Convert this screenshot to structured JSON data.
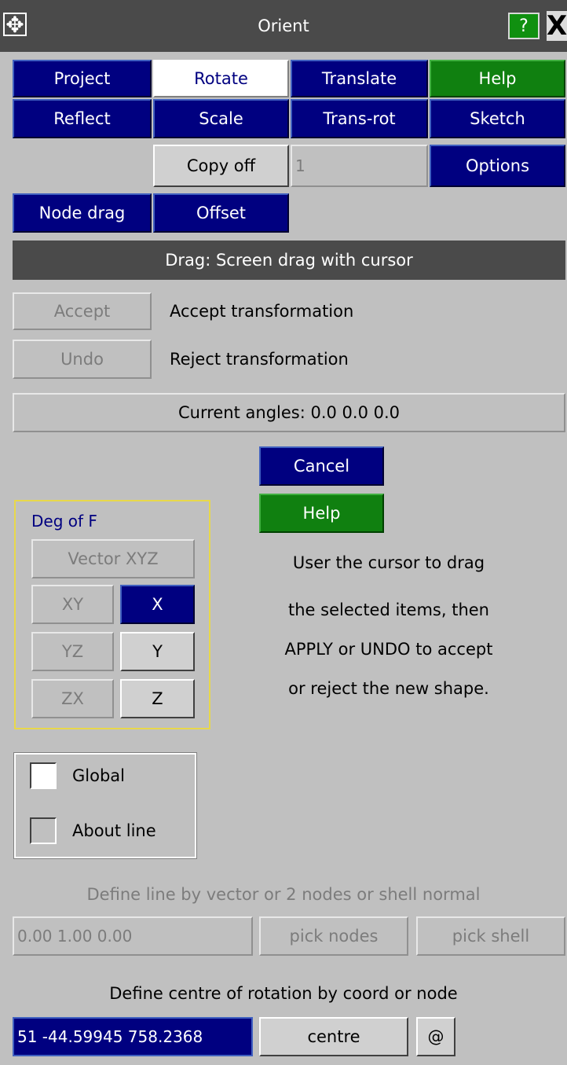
{
  "window": {
    "title": "Orient",
    "help_label": "?",
    "close_label": "X",
    "move_label": "✥"
  },
  "tabs": {
    "row1": [
      "Project",
      "Rotate",
      "Translate",
      "Help"
    ],
    "row2": [
      "Reflect",
      "Scale",
      "Trans-rot",
      "Sketch"
    ]
  },
  "copy": {
    "button_label": "Copy off",
    "count_value": "1",
    "options_label": "Options"
  },
  "modes": {
    "node_drag": "Node drag",
    "offset": "Offset"
  },
  "drag_mode_bar": "Drag: Screen drag with cursor",
  "accept": {
    "button": "Accept",
    "label": "Accept transformation"
  },
  "undo": {
    "button": "Undo",
    "label": "Reject transformation"
  },
  "current_angles": "Current angles: 0.0  0.0  0.0",
  "actions": {
    "cancel": "Cancel",
    "help": "Help"
  },
  "dof": {
    "title": "Deg of F",
    "vector": "Vector XYZ",
    "xy": "XY",
    "x": "X",
    "yz": "YZ",
    "y": "Y",
    "zx": "ZX",
    "z": "Z"
  },
  "instructions": [
    "User the cursor to drag",
    "the selected items, then",
    "APPLY or UNDO to accept",
    "or reject the new shape."
  ],
  "axis_mode": {
    "global": "Global",
    "about_line": "About line"
  },
  "line_def": {
    "label": "Define line by vector or 2 nodes or shell normal",
    "vector_value": "0.00 1.00 0.00",
    "pick_nodes": "pick nodes",
    "pick_shell": "pick shell"
  },
  "centre_def": {
    "label": "Define centre of rotation by coord or node",
    "coord_value": "51 -44.59945 758.2368",
    "centre_button": "centre",
    "at_button": "@"
  },
  "colors": {
    "navy": "#000080",
    "green": "#108010",
    "dark_grey": "#4a4a4a",
    "panel": "#c0c0c0",
    "highlight": "#ffff80"
  }
}
